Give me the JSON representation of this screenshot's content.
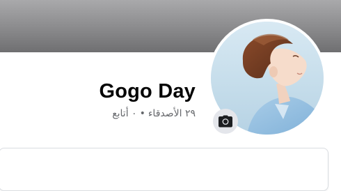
{
  "profile": {
    "name": "Gogo Day",
    "friends_count": "٢٩",
    "friends_label": "الأصدقاء",
    "separator": "•",
    "following_count": "٠",
    "following_label": "أتابع"
  },
  "icons": {
    "camera": "camera-icon"
  },
  "colors": {
    "cover_top": "#a9a9ab",
    "cover_bottom": "#6f6f71",
    "name_text": "#050505",
    "secondary_text": "#65676b",
    "camera_bg": "#e4e6eb"
  }
}
